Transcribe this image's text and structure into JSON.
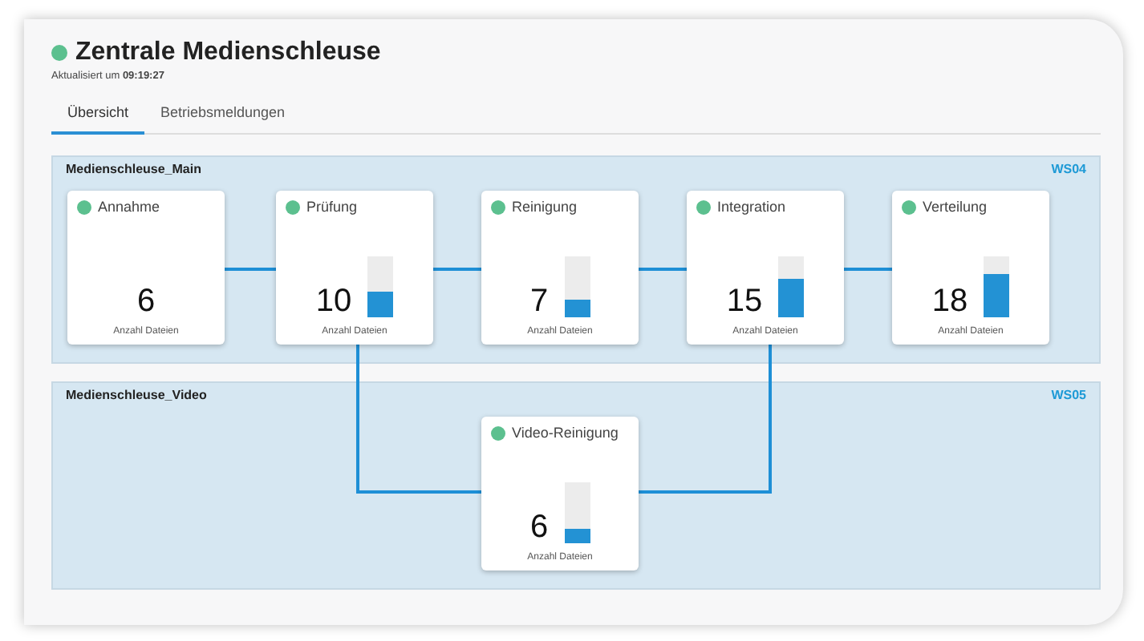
{
  "header": {
    "title": "Zentrale Medienschleuse",
    "color": "#5cc08f",
    "updated_label": "Aktualisiert um",
    "updated_time": "09:19:27"
  },
  "tabs": [
    {
      "label": "Übersicht",
      "selected": true
    },
    {
      "label": "Betriebsmeldungen",
      "selected": false
    }
  ],
  "panels": [
    {
      "name": "Medienschleuse_Main",
      "station": "WS04",
      "nodes": [
        {
          "name": "Annahme",
          "color": "#5cc08f",
          "count": "6",
          "caption": "Anzahl Dateien"
        },
        {
          "name": "Prüfung",
          "color": "#5cc08f",
          "count": "10",
          "caption": "Anzahl Dateien",
          "level": 0.42
        },
        {
          "name": "Reinigung",
          "color": "#5cc08f",
          "count": "7",
          "caption": "Anzahl Dateien",
          "level": 0.28
        },
        {
          "name": "Integration",
          "color": "#5cc08f",
          "count": "15",
          "caption": "Anzahl Dateien",
          "level": 0.62
        },
        {
          "name": "Verteilung",
          "color": "#5cc08f",
          "count": "18",
          "caption": "Anzahl Dateien",
          "level": 0.72
        }
      ]
    },
    {
      "name": "Medienschleuse_Video",
      "station": "WS05",
      "nodes": [
        {
          "name": "Video-Reinigung",
          "color": "#5cc08f",
          "count": "6",
          "caption": "Anzahl Dateien",
          "level": 0.24
        }
      ]
    }
  ]
}
